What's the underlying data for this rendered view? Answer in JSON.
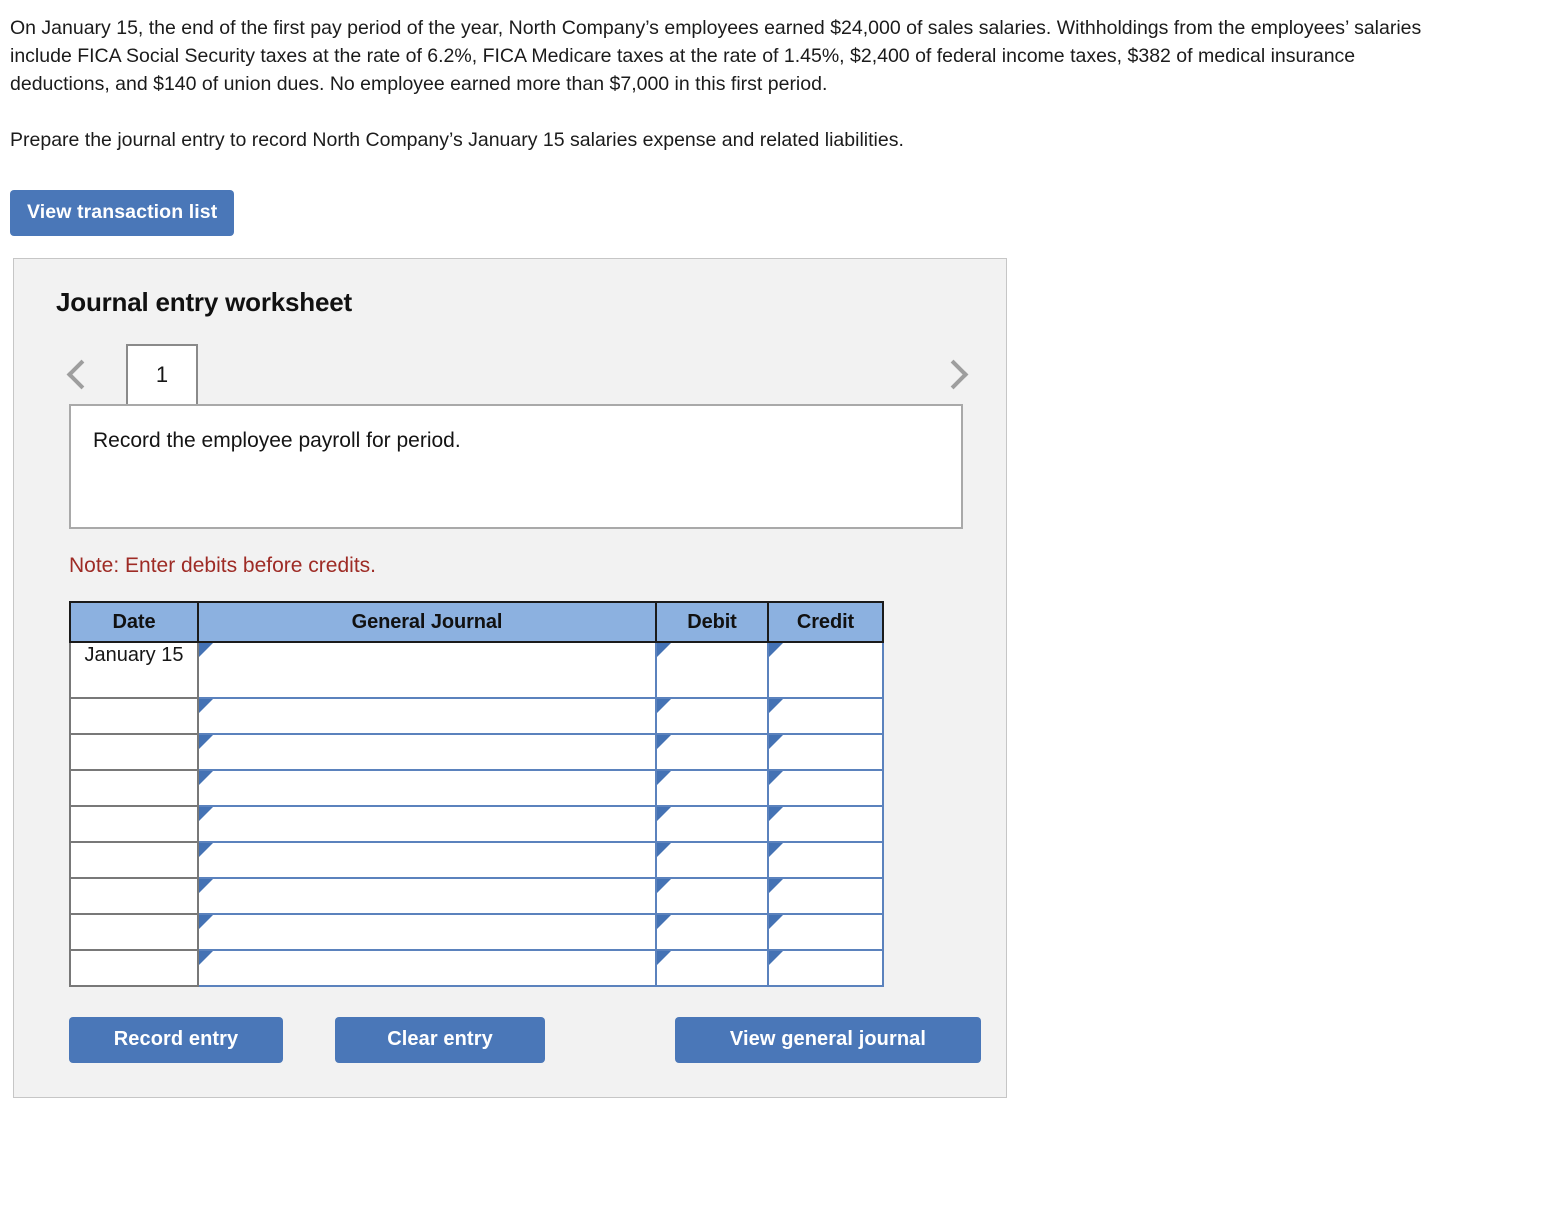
{
  "question": {
    "paragraph_1": "On January 15, the end of the first pay period of the year, North Company’s employees earned $24,000 of sales salaries. Withholdings from the employees’ salaries include FICA Social Security taxes at the rate of 6.2%, FICA Medicare taxes at the rate of 1.45%, $2,400 of federal income taxes, $382 of medical insurance deductions, and $140 of union dues. No employee earned more than $7,000 in this first period.",
    "paragraph_2": "Prepare the journal entry to record North Company’s January 15 salaries expense and related liabilities."
  },
  "toolbar": {
    "view_transaction_list_label": "View transaction list"
  },
  "worksheet": {
    "title": "Journal entry worksheet",
    "prev_arrow_icon": "chevron-left-icon",
    "next_arrow_icon": "chevron-right-icon",
    "tabs": [
      {
        "label": "1",
        "selected": true
      }
    ],
    "description": "Record the employee payroll for period.",
    "note": "Note: Enter debits before credits.",
    "table": {
      "headers": [
        "Date",
        "General Journal",
        "Debit",
        "Credit"
      ],
      "rows": [
        {
          "date": "January 15",
          "general_journal": "",
          "debit": "",
          "credit": ""
        },
        {
          "date": "",
          "general_journal": "",
          "debit": "",
          "credit": ""
        },
        {
          "date": "",
          "general_journal": "",
          "debit": "",
          "credit": ""
        },
        {
          "date": "",
          "general_journal": "",
          "debit": "",
          "credit": ""
        },
        {
          "date": "",
          "general_journal": "",
          "debit": "",
          "credit": ""
        },
        {
          "date": "",
          "general_journal": "",
          "debit": "",
          "credit": ""
        },
        {
          "date": "",
          "general_journal": "",
          "debit": "",
          "credit": ""
        },
        {
          "date": "",
          "general_journal": "",
          "debit": "",
          "credit": ""
        },
        {
          "date": "",
          "general_journal": "",
          "debit": "",
          "credit": ""
        }
      ]
    },
    "actions": {
      "record_entry_label": "Record entry",
      "clear_entry_label": "Clear entry",
      "view_general_journal_label": "View general journal"
    }
  },
  "colors": {
    "button_blue": "#4a77b8",
    "table_header_blue": "#8cb1e0",
    "cell_border_blue": "#5b82bd",
    "note_red": "#9e2b25",
    "panel_grey": "#f2f2f2"
  }
}
